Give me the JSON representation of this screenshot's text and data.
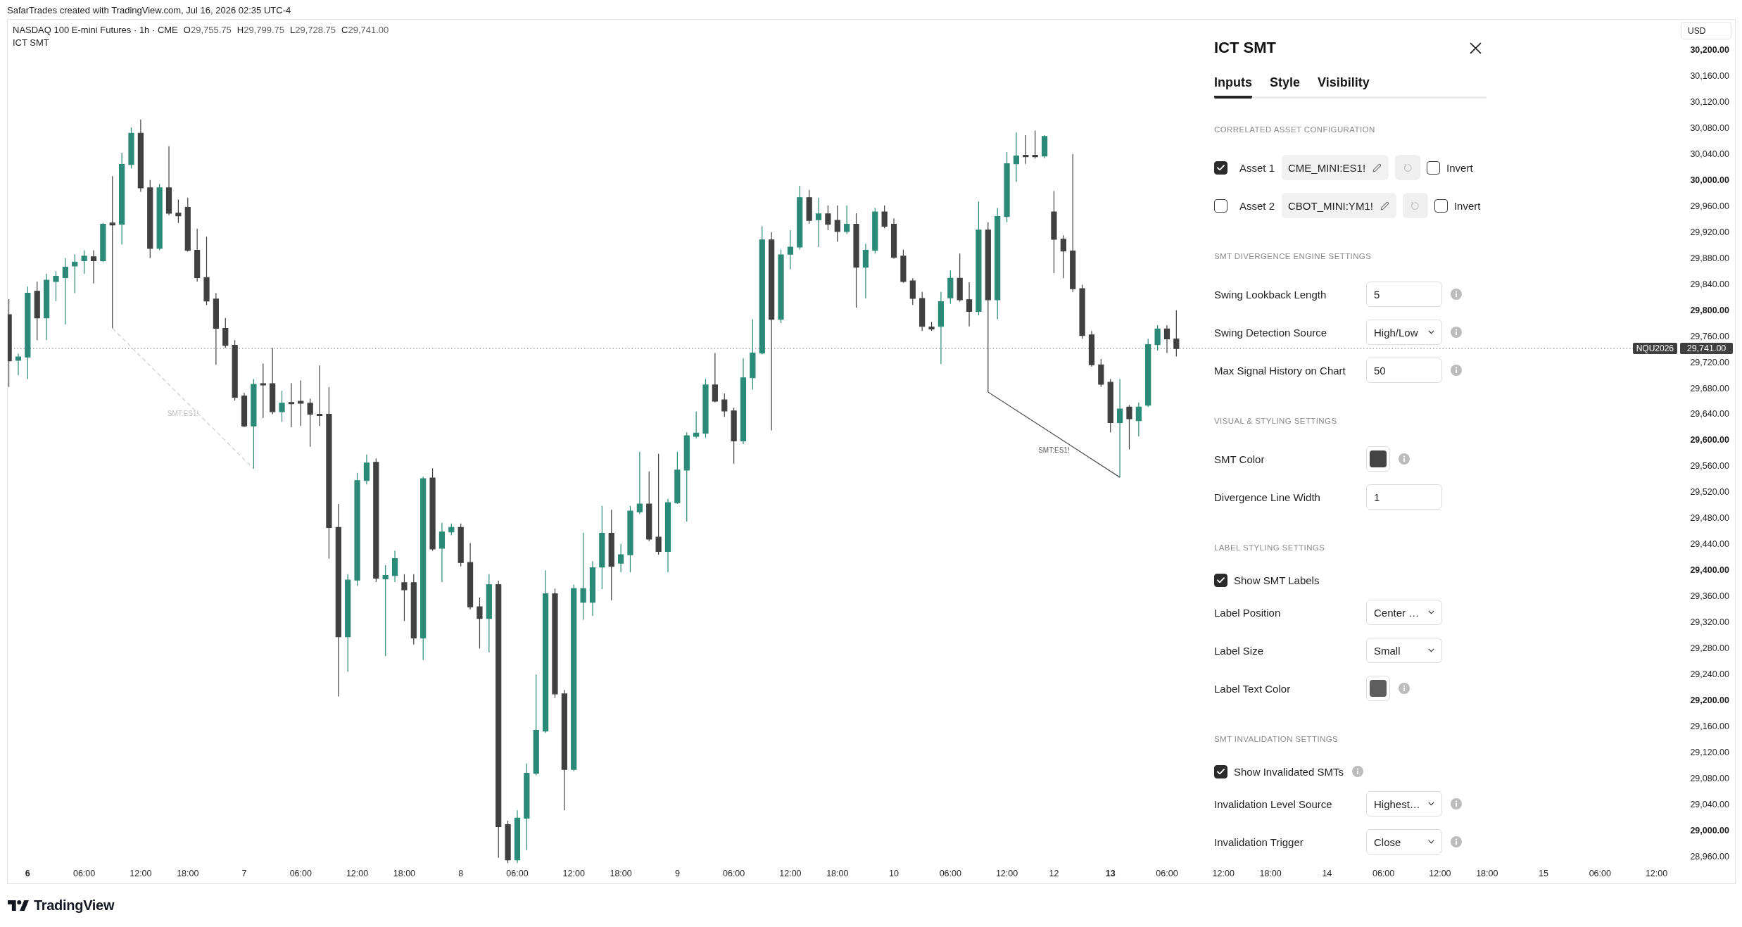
{
  "attribution": "SafarTrades created with TradingView.com, Jul 16, 2026 02:35 UTC-4",
  "chart": {
    "legend": {
      "title": "NASDAQ 100 E-mini Futures · 1h · CME",
      "ohlc": [
        {
          "key": "O",
          "value": "29,755.75"
        },
        {
          "key": "H",
          "value": "29,799.75"
        },
        {
          "key": "L",
          "value": "29,728.75"
        },
        {
          "key": "C",
          "value": "29,741.00"
        }
      ],
      "indicator": "ICT SMT"
    },
    "smt_signals": [
      {
        "label": "SMT:ES1!",
        "invalidated": true
      },
      {
        "label": "SMT:ES1!",
        "invalidated": false
      }
    ],
    "last_price": {
      "symbol": "NQU2026",
      "price": "29,741.00"
    },
    "price_axis": {
      "currency": "USD",
      "labels": [
        {
          "text": "30,200.00",
          "bold": true
        },
        {
          "text": "30,160.00",
          "bold": false
        },
        {
          "text": "30,120.00",
          "bold": false
        },
        {
          "text": "30,080.00",
          "bold": false
        },
        {
          "text": "30,040.00",
          "bold": false
        },
        {
          "text": "30,000.00",
          "bold": true
        },
        {
          "text": "29,960.00",
          "bold": false
        },
        {
          "text": "29,920.00",
          "bold": false
        },
        {
          "text": "29,880.00",
          "bold": false
        },
        {
          "text": "29,840.00",
          "bold": false
        },
        {
          "text": "29,800.00",
          "bold": true
        },
        {
          "text": "29,760.00",
          "bold": false
        },
        {
          "text": "29,720.00",
          "bold": false
        },
        {
          "text": "29,680.00",
          "bold": false
        },
        {
          "text": "29,640.00",
          "bold": false
        },
        {
          "text": "29,600.00",
          "bold": true
        },
        {
          "text": "29,560.00",
          "bold": false
        },
        {
          "text": "29,520.00",
          "bold": false
        },
        {
          "text": "29,480.00",
          "bold": false
        },
        {
          "text": "29,440.00",
          "bold": false
        },
        {
          "text": "29,400.00",
          "bold": true
        },
        {
          "text": "29,360.00",
          "bold": false
        },
        {
          "text": "29,320.00",
          "bold": false
        },
        {
          "text": "29,280.00",
          "bold": false
        },
        {
          "text": "29,240.00",
          "bold": false
        },
        {
          "text": "29,200.00",
          "bold": true
        },
        {
          "text": "29,160.00",
          "bold": false
        },
        {
          "text": "29,120.00",
          "bold": false
        },
        {
          "text": "29,080.00",
          "bold": false
        },
        {
          "text": "29,040.00",
          "bold": false
        },
        {
          "text": "29,000.00",
          "bold": true
        },
        {
          "text": "28,960.00",
          "bold": false
        }
      ]
    },
    "time_axis": {
      "labels": [
        {
          "text": "6",
          "bold": true
        },
        {
          "text": "06:00",
          "bold": false
        },
        {
          "text": "12:00",
          "bold": false
        },
        {
          "text": "18:00",
          "bold": false
        },
        {
          "text": "7",
          "bold": false
        },
        {
          "text": "06:00",
          "bold": false
        },
        {
          "text": "12:00",
          "bold": false
        },
        {
          "text": "18:00",
          "bold": false
        },
        {
          "text": "8",
          "bold": false
        },
        {
          "text": "06:00",
          "bold": false
        },
        {
          "text": "12:00",
          "bold": false
        },
        {
          "text": "18:00",
          "bold": false
        },
        {
          "text": "9",
          "bold": false
        },
        {
          "text": "06:00",
          "bold": false
        },
        {
          "text": "12:00",
          "bold": false
        },
        {
          "text": "18:00",
          "bold": false
        },
        {
          "text": "10",
          "bold": false
        },
        {
          "text": "06:00",
          "bold": false
        },
        {
          "text": "12:00",
          "bold": false
        },
        {
          "text": "12",
          "bold": false
        },
        {
          "text": "13",
          "bold": true
        },
        {
          "text": "06:00",
          "bold": false
        },
        {
          "text": "12:00",
          "bold": false
        },
        {
          "text": "18:00",
          "bold": false
        },
        {
          "text": "14",
          "bold": false
        },
        {
          "text": "06:00",
          "bold": false
        },
        {
          "text": "12:00",
          "bold": false
        },
        {
          "text": "18:00",
          "bold": false
        },
        {
          "text": "15",
          "bold": false
        },
        {
          "text": "06:00",
          "bold": false
        },
        {
          "text": "12:00",
          "bold": false
        }
      ]
    }
  },
  "settings": {
    "title": "ICT SMT",
    "tabs": [
      {
        "label": "Inputs",
        "selected": true
      },
      {
        "label": "Style",
        "selected": false
      },
      {
        "label": "Visibility",
        "selected": false
      }
    ],
    "sections": [
      {
        "heading": "CORRELATED ASSET CONFIGURATION",
        "rows": [
          {
            "kind": "asset",
            "label": "Asset 1",
            "checked": true,
            "symbol": "CME_MINI:ES1!",
            "reset_disabled": true,
            "invert": {
              "label": "Invert",
              "checked": false
            }
          },
          {
            "kind": "asset",
            "label": "Asset 2",
            "checked": false,
            "symbol": "CBOT_MINI:YM1!",
            "reset_disabled": true,
            "invert": {
              "label": "Invert",
              "checked": false
            }
          }
        ]
      },
      {
        "heading": "SMT DIVERGENCE ENGINE SETTINGS",
        "rows": [
          {
            "kind": "number",
            "label": "Swing Lookback Length",
            "value": "5",
            "info": true
          },
          {
            "kind": "select",
            "label": "Swing Detection Source",
            "value": "High/Low",
            "info": true
          },
          {
            "kind": "number",
            "label": "Max Signal History on Chart",
            "value": "50",
            "info": true
          }
        ]
      },
      {
        "heading": "VISUAL & STYLING SETTINGS",
        "rows": [
          {
            "kind": "color",
            "label": "SMT Color",
            "color": "#444444",
            "info": true
          },
          {
            "kind": "number",
            "label": "Divergence Line Width",
            "value": "1",
            "info": false
          }
        ]
      },
      {
        "heading": "LABEL STYLING SETTINGS",
        "rows": [
          {
            "kind": "checkbox",
            "label": "Show SMT Labels",
            "checked": true,
            "info": false
          },
          {
            "kind": "select",
            "label": "Label Position",
            "value": "Center …",
            "info": false
          },
          {
            "kind": "select",
            "label": "Label Size",
            "value": "Small",
            "info": false
          },
          {
            "kind": "color",
            "label": "Label Text Color",
            "color": "#5e5e5e",
            "info": true
          }
        ]
      },
      {
        "heading": "SMT INVALIDATION SETTINGS",
        "rows": [
          {
            "kind": "checkbox",
            "label": "Show Invalidated SMTs",
            "checked": true,
            "info": true
          },
          {
            "kind": "select",
            "label": "Invalidation Level Source",
            "value": "Highest…",
            "info": true
          },
          {
            "kind": "select",
            "label": "Invalidation Trigger",
            "value": "Close",
            "info": true
          }
        ]
      }
    ]
  },
  "footer": {
    "brand": "TradingView"
  }
}
